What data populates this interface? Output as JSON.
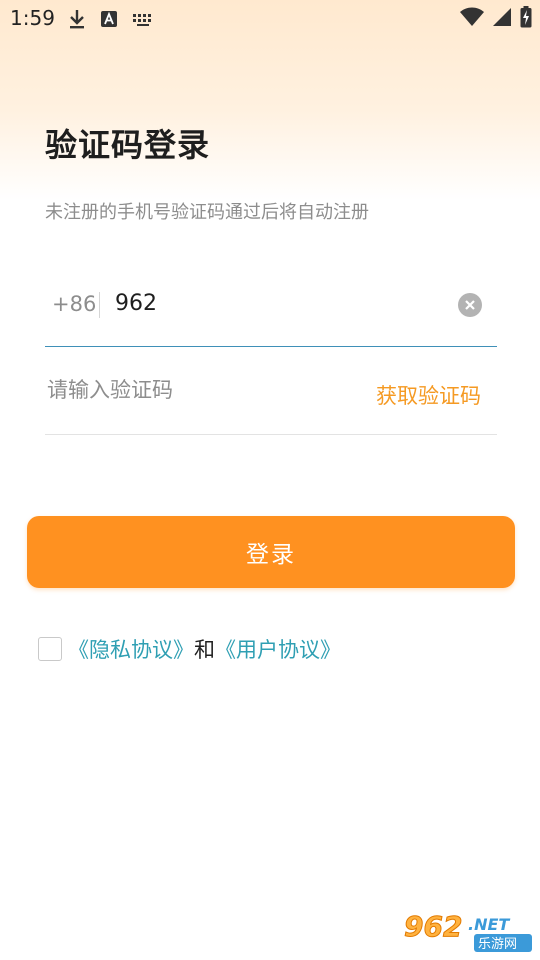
{
  "status_bar": {
    "time": "1:59",
    "left_icons": [
      "download-icon",
      "font-app-icon",
      "keyboard-icon"
    ],
    "right_icons": [
      "wifi-icon",
      "signal-icon",
      "battery-charging-icon"
    ]
  },
  "header": {
    "title": "验证码登录",
    "subtitle": "未注册的手机号验证码通过后将自动注册"
  },
  "form": {
    "country_code": "+86",
    "phone_value": "962",
    "code_placeholder": "请输入验证码",
    "get_code_label": "获取验证码",
    "login_label": "登录"
  },
  "agreement": {
    "privacy_link": "《隐私协议》",
    "and_text": "和",
    "user_link": "《用户协议》",
    "checked": false
  },
  "watermark": {
    "brand": "962.NET",
    "site": "乐游网"
  },
  "colors": {
    "accent_orange": "#ff9120",
    "get_code_orange": "#f59a23",
    "link_teal": "#2f9fb3",
    "input_underline": "#3f90b8"
  }
}
